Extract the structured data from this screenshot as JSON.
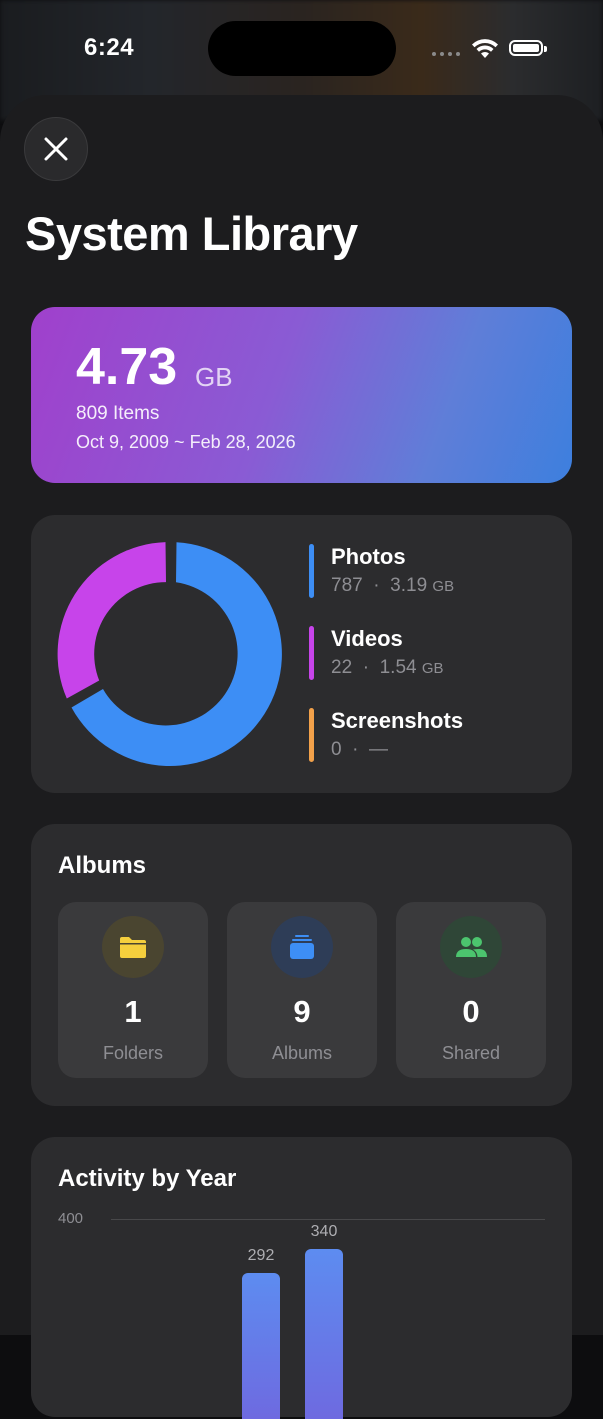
{
  "status_bar": {
    "time": "6:24"
  },
  "sheet": {
    "title": "System Library"
  },
  "summary": {
    "size_value": "4.73",
    "size_unit": "GB",
    "items": "809 Items",
    "date_range": "Oct 9, 2009 ~ Feb 28, 2026"
  },
  "breakdown": {
    "legend": [
      {
        "name": "Photos",
        "count": "787",
        "sep": "·",
        "size": "3.19",
        "unit": "GB",
        "color": "#3d8ef5"
      },
      {
        "name": "Videos",
        "count": "22",
        "sep": "·",
        "size": "1.54",
        "unit": "GB",
        "color": "#c744ea"
      },
      {
        "name": "Screenshots",
        "count": "0",
        "sep": "·",
        "size": "—",
        "unit": "",
        "color": "#f2a14a"
      }
    ]
  },
  "albums": {
    "title": "Albums",
    "tiles": [
      {
        "value": "1",
        "label": "Folders",
        "icon": "folder-icon",
        "color": "#f5cf3d"
      },
      {
        "value": "9",
        "label": "Albums",
        "icon": "album-stack-icon",
        "color": "#3d8ef5"
      },
      {
        "value": "0",
        "label": "Shared",
        "icon": "people-icon",
        "color": "#4cc46e"
      }
    ]
  },
  "activity": {
    "title": "Activity by Year",
    "chart_data": {
      "type": "bar",
      "title": "Activity by Year",
      "ylim": [
        0,
        400
      ],
      "y_ticks": [
        "400"
      ],
      "values": [
        292,
        340
      ],
      "value_labels": [
        "292",
        "340"
      ]
    }
  }
}
